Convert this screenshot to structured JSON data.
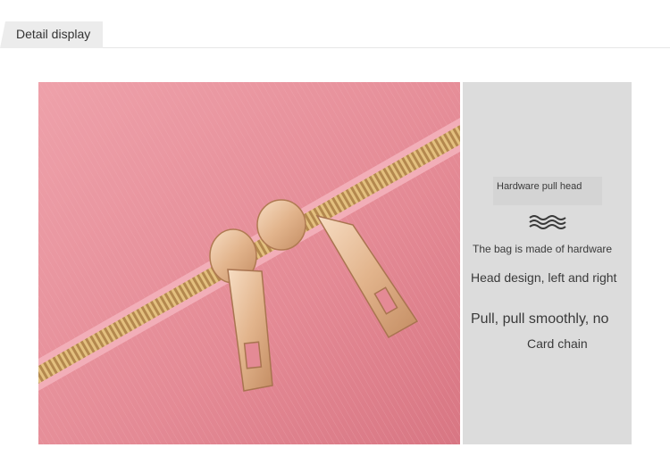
{
  "header": {
    "title": "Detail display"
  },
  "side_panel": {
    "hardware_label": "Hardware pull head",
    "line1": "The bag is made of hardware",
    "line2": "Head design, left and right",
    "line3": "Pull, pull smoothly, no",
    "line4": "Card chain"
  },
  "photo": {
    "icon": "zipper-pull-photo",
    "colors": {
      "fabric": "#e48c97",
      "zipper": "#c9a26a",
      "hardware": "#e9c4a0"
    }
  },
  "colors": {
    "panel": "#dcdcdc",
    "header_tab": "#ececec"
  }
}
